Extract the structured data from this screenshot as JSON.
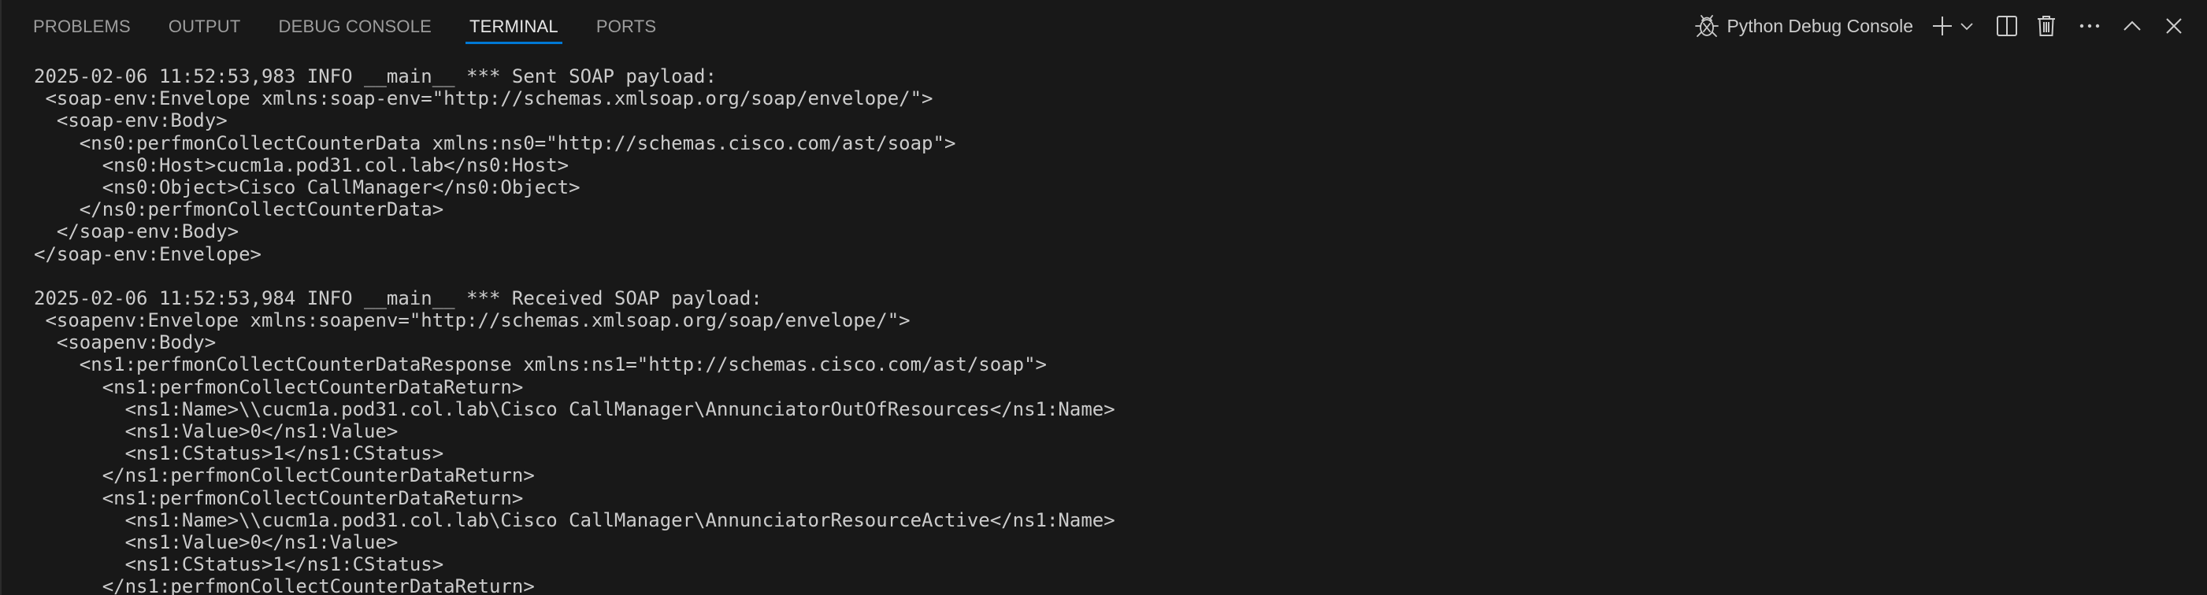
{
  "panel": {
    "tabs": [
      {
        "label": "PROBLEMS",
        "active": false
      },
      {
        "label": "OUTPUT",
        "active": false
      },
      {
        "label": "DEBUG CONSOLE",
        "active": false
      },
      {
        "label": "TERMINAL",
        "active": true
      },
      {
        "label": "PORTS",
        "active": false
      }
    ],
    "active_terminal": {
      "icon": "debug-bug-icon",
      "label": "Python Debug Console"
    },
    "actions": [
      {
        "name": "new-terminal",
        "icon": "plus-icon"
      },
      {
        "name": "terminal-profiles",
        "icon": "chevron-down-icon"
      },
      {
        "name": "split-terminal",
        "icon": "split-icon"
      },
      {
        "name": "kill-terminal",
        "icon": "trash-icon"
      },
      {
        "name": "more-actions",
        "icon": "ellipsis-icon"
      },
      {
        "name": "maximize-panel",
        "icon": "chevron-up-icon"
      },
      {
        "name": "close-panel",
        "icon": "close-icon"
      }
    ]
  },
  "colors": {
    "background": "#181818",
    "text": "#cccccc",
    "tab_inactive": "#9d9d9d",
    "tab_active": "#e7e7e7",
    "accent": "#0078d4"
  },
  "terminal": {
    "lines": [
      "2025-02-06 11:52:53,983 INFO __main__ *** Sent SOAP payload:",
      " <soap-env:Envelope xmlns:soap-env=\"http://schemas.xmlsoap.org/soap/envelope/\">",
      "  <soap-env:Body>",
      "    <ns0:perfmonCollectCounterData xmlns:ns0=\"http://schemas.cisco.com/ast/soap\">",
      "      <ns0:Host>cucm1a.pod31.col.lab</ns0:Host>",
      "      <ns0:Object>Cisco CallManager</ns0:Object>",
      "    </ns0:perfmonCollectCounterData>",
      "  </soap-env:Body>",
      "</soap-env:Envelope>",
      "",
      "2025-02-06 11:52:53,984 INFO __main__ *** Received SOAP payload:",
      " <soapenv:Envelope xmlns:soapenv=\"http://schemas.xmlsoap.org/soap/envelope/\">",
      "  <soapenv:Body>",
      "    <ns1:perfmonCollectCounterDataResponse xmlns:ns1=\"http://schemas.cisco.com/ast/soap\">",
      "      <ns1:perfmonCollectCounterDataReturn>",
      "        <ns1:Name>\\\\cucm1a.pod31.col.lab\\Cisco CallManager\\AnnunciatorOutOfResources</ns1:Name>",
      "        <ns1:Value>0</ns1:Value>",
      "        <ns1:CStatus>1</ns1:CStatus>",
      "      </ns1:perfmonCollectCounterDataReturn>",
      "      <ns1:perfmonCollectCounterDataReturn>",
      "        <ns1:Name>\\\\cucm1a.pod31.col.lab\\Cisco CallManager\\AnnunciatorResourceActive</ns1:Name>",
      "        <ns1:Value>0</ns1:Value>",
      "        <ns1:CStatus>1</ns1:CStatus>",
      "      </ns1:perfmonCollectCounterDataReturn>"
    ]
  }
}
